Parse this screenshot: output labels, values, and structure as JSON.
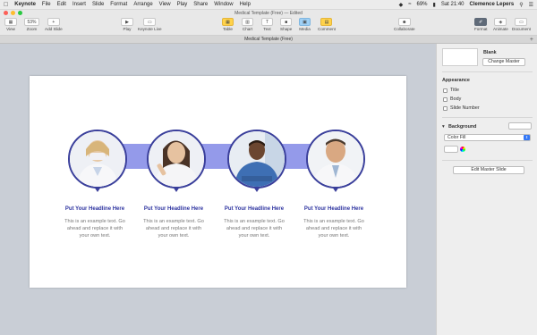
{
  "menubar": {
    "apple": "",
    "app": "Keynote",
    "items": [
      "File",
      "Edit",
      "Insert",
      "Slide",
      "Format",
      "Arrange",
      "View",
      "Play",
      "Share",
      "Window",
      "Help"
    ],
    "battery": "69%",
    "clock": "Sat 21:40",
    "user": "Clemence Lepers"
  },
  "window": {
    "title": "Medical Template (Free) — Edited"
  },
  "toolbar": {
    "view": "View",
    "zoom_value": "53%",
    "zoom": "Zoom",
    "add_slide": "Add Slide",
    "play": "Play",
    "keynote_live": "Keynote Live",
    "table": "Table",
    "chart": "Chart",
    "text": "Text",
    "shape": "Shape",
    "media": "Media",
    "comment": "Comment",
    "collaborate": "Collaborate",
    "format": "Format",
    "animate": "Animate",
    "document": "Document"
  },
  "tab": {
    "title": "Medical Template (Free)"
  },
  "slide": {
    "items": [
      {
        "headline": "Put Your Headline Here",
        "body": "This is an example text. Go ahead and replace it with your own text."
      },
      {
        "headline": "Put Your Headline Here",
        "body": "This is an example text. Go ahead and replace it with your own text."
      },
      {
        "headline": "Put Your Headline Here",
        "body": "This is an example text. Go ahead and replace it with your own text."
      },
      {
        "headline": "Put Your Headline Here",
        "body": "This is an example text. Go ahead and replace it with your own text."
      }
    ]
  },
  "panel": {
    "master_name": "Blank",
    "change_master": "Change Master",
    "appearance": "Appearance",
    "title": "Title",
    "body": "Body",
    "slide_number": "Slide Number",
    "background": "Background",
    "fill_type": "Color Fill",
    "edit_master": "Edit Master Slide"
  },
  "colors": {
    "accent": "#3a3f9b",
    "band": "#8188e6",
    "headline": "#2e34a0"
  }
}
